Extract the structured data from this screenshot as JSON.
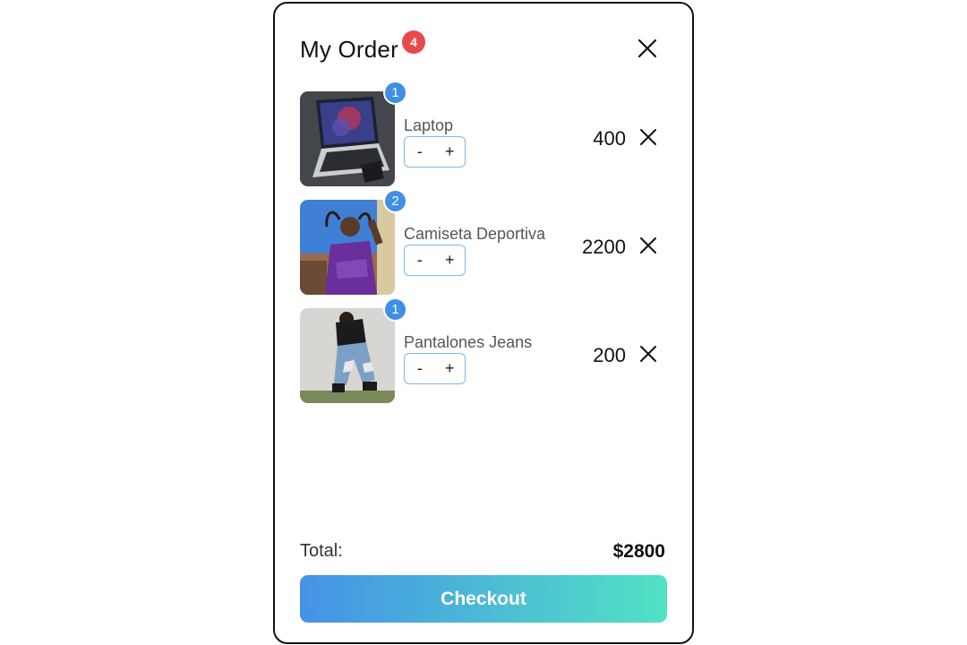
{
  "header": {
    "title": "My Order",
    "badge_count": "4",
    "close_icon": "close-icon"
  },
  "items": [
    {
      "name": "Laptop",
      "quantity": "1",
      "price": "400",
      "decrement": "-",
      "increment": "+",
      "image": "laptop-photo"
    },
    {
      "name": "Camiseta Deportiva",
      "quantity": "2",
      "price": "2200",
      "decrement": "-",
      "increment": "+",
      "image": "sports-shirt-photo"
    },
    {
      "name": "Pantalones Jeans",
      "quantity": "1",
      "price": "200",
      "decrement": "-",
      "increment": "+",
      "image": "jeans-photo"
    }
  ],
  "footer": {
    "total_label": "Total:",
    "total_value": "$2800",
    "checkout_label": "Checkout"
  },
  "colors": {
    "badge_red": "#e84a4a",
    "qty_blue": "#3f8fe6",
    "gradient_start": "#4592e6",
    "gradient_end": "#51e2c4"
  }
}
